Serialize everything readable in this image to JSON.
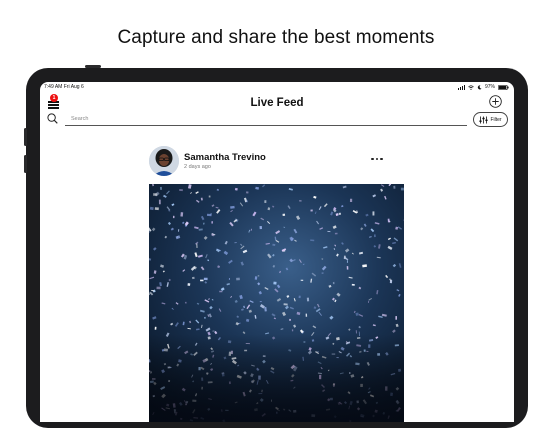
{
  "headline": "Capture and share the best moments",
  "status_bar": {
    "time": "7:49 AM",
    "date": "Fri Aug 6",
    "battery": "97%"
  },
  "nav": {
    "title": "Live Feed",
    "menu_badge": "1",
    "menu_icon": "hamburger-menu-icon",
    "add_icon": "plus-circle-icon"
  },
  "search": {
    "placeholder": "Search",
    "filter_label": "Filter"
  },
  "post": {
    "author": "Samantha Trevino",
    "time_ago": "2 days ago",
    "image_description_icon": "confetti-photo"
  },
  "colors": {
    "badge": "#e11111",
    "device_frame": "#1c1c1e"
  }
}
